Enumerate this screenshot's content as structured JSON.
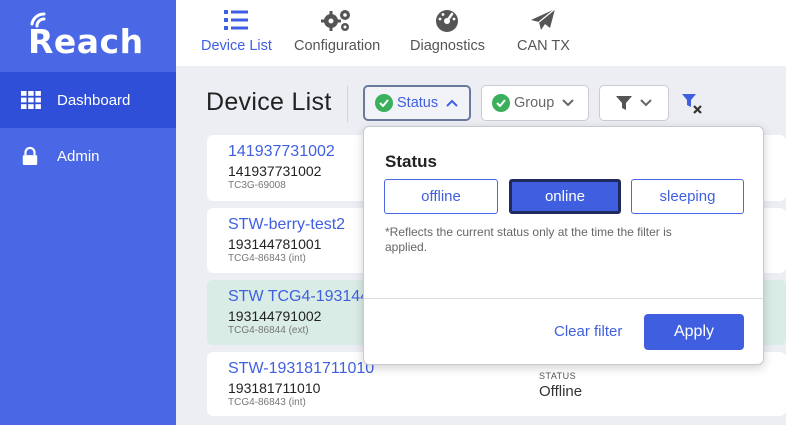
{
  "app": {
    "logo_text": "Reach"
  },
  "sidebar": {
    "items": [
      {
        "label": "Dashboard",
        "icon": "grid-icon",
        "active": true
      },
      {
        "label": "Admin",
        "icon": "lock-icon",
        "active": false
      }
    ]
  },
  "toolbar": {
    "tabs": [
      {
        "label": "Device List",
        "icon": "list-icon",
        "active": true
      },
      {
        "label": "Configuration",
        "icon": "gears-icon",
        "active": false
      },
      {
        "label": "Diagnostics",
        "icon": "gauge-icon",
        "active": false
      },
      {
        "label": "CAN TX",
        "icon": "paper-plane-icon",
        "active": false
      }
    ]
  },
  "page": {
    "title": "Device List"
  },
  "filters": {
    "status_label": "Status",
    "group_label": "Group"
  },
  "devices": [
    {
      "name": "141937731002",
      "serial": "141937731002",
      "model": "TC3G-69008",
      "status_label": "",
      "status": ""
    },
    {
      "name": "STW-berry-test2",
      "serial": "193144781001",
      "model": "TCG4-86843 (int)",
      "status_label": "",
      "status": ""
    },
    {
      "name": "STW TCG4-193144",
      "serial": "193144791002",
      "model": "TCG4-86844 (ext)",
      "status_label": "",
      "status": ""
    },
    {
      "name": "STW-193181711010",
      "serial": "193181711010",
      "model": "TCG4-86843 (int)",
      "status_label": "STATUS",
      "status": "Offline"
    }
  ],
  "status_popover": {
    "title": "Status",
    "options": [
      {
        "label": "offline",
        "selected": false
      },
      {
        "label": "online",
        "selected": true
      },
      {
        "label": "sleeping",
        "selected": false
      }
    ],
    "note": "*Reflects the current status only at the time the filter is applied.",
    "clear_label": "Clear filter",
    "apply_label": "Apply"
  },
  "colors": {
    "sidebar": "#4a68e6",
    "sidebar_active": "#2f4fd8",
    "accent": "#3f5fe0",
    "check_green": "#3bb05c",
    "highlight_row": "#d9ece6"
  }
}
